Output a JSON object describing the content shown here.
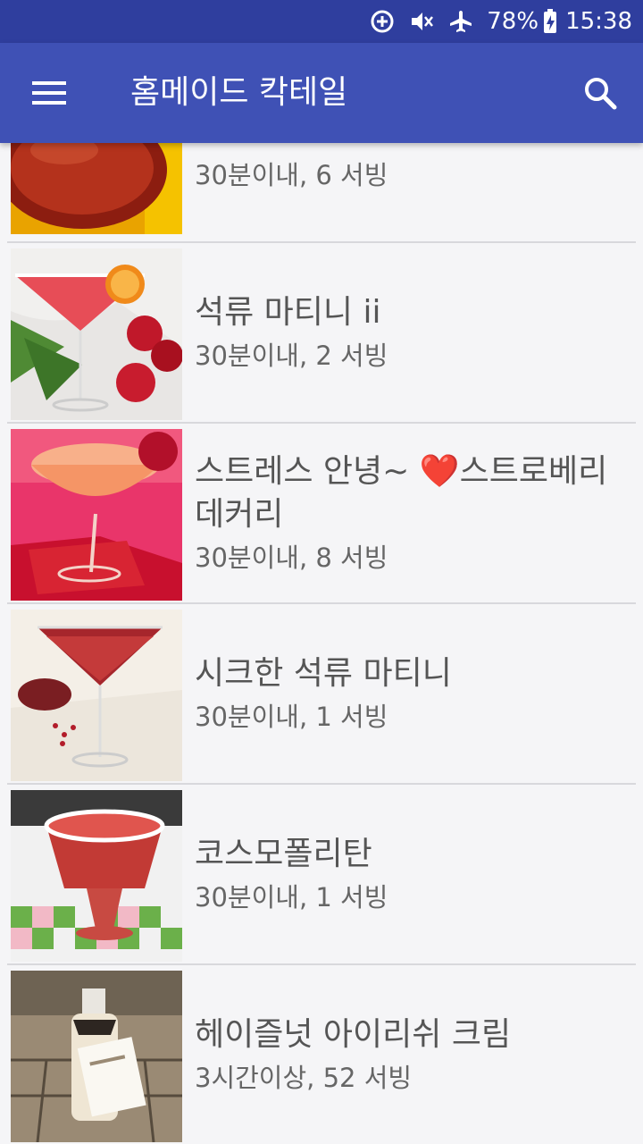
{
  "status_bar": {
    "battery": "78%",
    "time": "15:38"
  },
  "app_bar": {
    "title": "홈메이드 칵테일"
  },
  "recipes": [
    {
      "name": "",
      "meta": "30분이내, 6 서빙"
    },
    {
      "name": "석류 마티니 ii",
      "meta": "30분이내, 2 서빙"
    },
    {
      "name": "스트레스 안녕~ ❤️스트로베리 데커리",
      "meta": "30분이내, 8 서빙"
    },
    {
      "name": "시크한 석류 마티니",
      "meta": "30분이내, 1 서빙"
    },
    {
      "name": "코스모폴리탄",
      "meta": "30분이내, 1 서빙"
    },
    {
      "name": "헤이즐넛 아이리쉬 크림",
      "meta": "3시간이상, 52 서빙"
    }
  ],
  "colors": {
    "status_bar": "#2f3e9e",
    "app_bar": "#3f51b5",
    "background": "#f5f5f7",
    "text_primary": "#555555",
    "text_secondary": "#666666"
  },
  "icons": {
    "menu": "hamburger-menu-icon",
    "search": "search-icon",
    "data_saver": "data-saver-icon",
    "mute": "vibrate-mute-icon",
    "airplane": "airplane-icon",
    "battery": "battery-charging-icon"
  }
}
